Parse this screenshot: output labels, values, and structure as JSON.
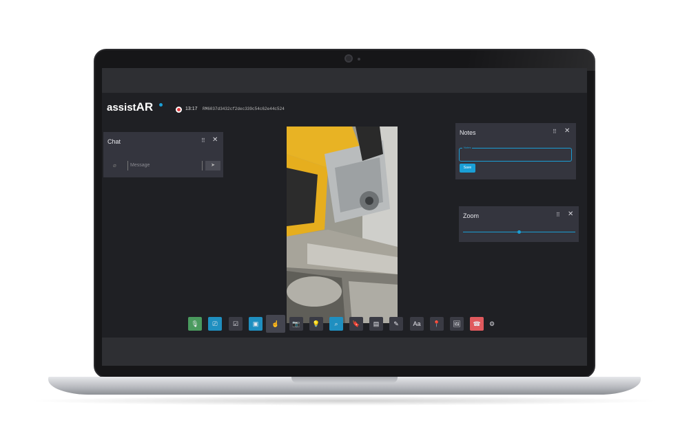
{
  "brand": {
    "logo_main": "assist",
    "logo_ar": "AR"
  },
  "header": {
    "timer": "13:17",
    "session_id": "RM6037d3432cf2dec339c54c62e44c524"
  },
  "chat": {
    "title": "Chat",
    "grip_icon": "⠿",
    "close_icon": "✕",
    "message_placeholder": "Message",
    "attach_icon": "paperclip-icon",
    "send_icon": "send-icon"
  },
  "notes": {
    "title": "Notes",
    "grip_icon": "⠿",
    "close_icon": "✕",
    "field_label": "Notes",
    "save_label": "Save"
  },
  "zoom": {
    "title": "Zoom",
    "grip_icon": "⠿",
    "close_icon": "✕",
    "level": 0.5
  },
  "colors": {
    "accent": "#1a9fd6",
    "mic": "#4a9a5e",
    "hangup": "#e05a5e",
    "panel": "#34353e",
    "app_bg": "#1f2024"
  },
  "toolbar": [
    {
      "icon": "microphone-icon",
      "glyph": "🎙",
      "style": "green"
    },
    {
      "icon": "share-screen-icon",
      "glyph": "⎚",
      "style": "blue"
    },
    {
      "icon": "checklist-icon",
      "glyph": "☑",
      "style": ""
    },
    {
      "icon": "save-icon",
      "glyph": "▣",
      "style": "blue"
    },
    {
      "icon": "hand-pointer-icon",
      "glyph": "☝",
      "style": "active"
    },
    {
      "icon": "camera-icon",
      "glyph": "📷",
      "style": ""
    },
    {
      "icon": "flashlight-icon",
      "glyph": "💡",
      "style": ""
    },
    {
      "icon": "zoom-icon",
      "glyph": "⌕",
      "style": "blue"
    },
    {
      "icon": "bookmark-icon",
      "glyph": "🔖",
      "style": ""
    },
    {
      "icon": "document-icon",
      "glyph": "▤",
      "style": ""
    },
    {
      "icon": "pencil-icon",
      "glyph": "✎",
      "style": ""
    },
    {
      "icon": "text-size-icon",
      "glyph": "Aa",
      "style": ""
    },
    {
      "icon": "location-pin-icon",
      "glyph": "📍",
      "style": ""
    },
    {
      "icon": "image-icon",
      "glyph": "🖼",
      "style": ""
    },
    {
      "icon": "hang-up-icon",
      "glyph": "☎",
      "style": "red"
    }
  ],
  "settings_icon": "⚙"
}
